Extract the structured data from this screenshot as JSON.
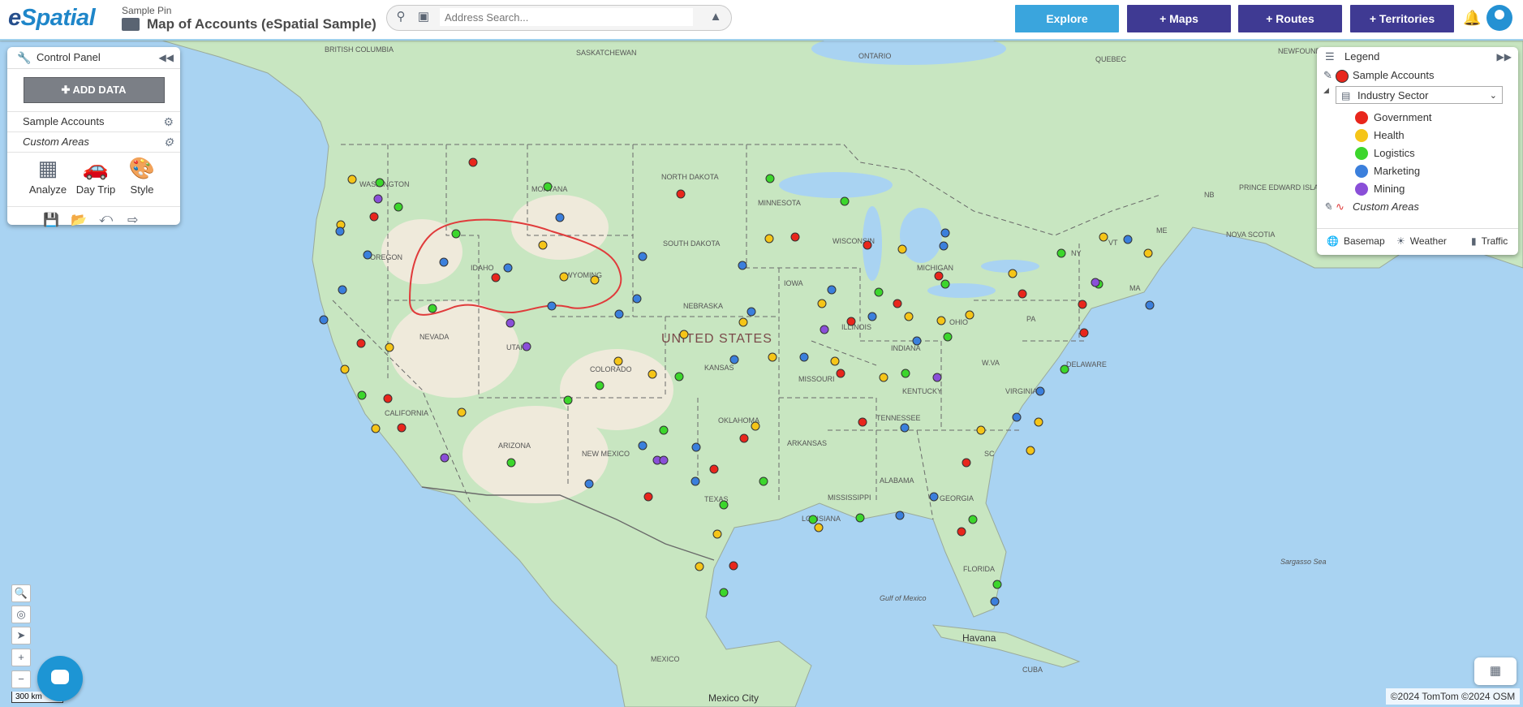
{
  "header": {
    "logo_prefix": "e",
    "logo_rest": "Spatial",
    "subtitle": "Sample Pin",
    "map_title": "Map of Accounts (eSpatial Sample)",
    "search_placeholder": "Address Search...",
    "nav": {
      "explore": "Explore",
      "maps": "+ Maps",
      "routes": "+ Routes",
      "territories": "+ Territories"
    }
  },
  "control_panel": {
    "title": "Control Panel",
    "add_data": "ADD DATA",
    "layers": [
      "Sample Accounts",
      "Custom Areas"
    ],
    "tools": [
      "Analyze",
      "Day Trip",
      "Style"
    ]
  },
  "legend": {
    "title": "Legend",
    "layer": "Sample Accounts",
    "group_by": "Industry Sector",
    "categories": [
      {
        "label": "Government",
        "color": "#e8261c"
      },
      {
        "label": "Health",
        "color": "#f5c518"
      },
      {
        "label": "Logistics",
        "color": "#3cd62c"
      },
      {
        "label": "Marketing",
        "color": "#3b7fdc"
      },
      {
        "label": "Mining",
        "color": "#8a4fd8"
      }
    ],
    "areas_label": "Custom Areas",
    "footer": [
      "Basemap",
      "Weather",
      "Traffic"
    ]
  },
  "map": {
    "country_label": "UNITED STATES",
    "labels": [
      "BRITISH COLUMBIA",
      "SASKATCHEWAN",
      "ONTARIO",
      "QUEBEC",
      "NEWFOUNDLAND AND LABRADOR",
      "WASHINGTON",
      "OREGON",
      "IDAHO",
      "MONTANA",
      "WYOMING",
      "NORTH DAKOTA",
      "SOUTH DAKOTA",
      "MINNESOTA",
      "NEBRASKA",
      "IOWA",
      "WISCONSIN",
      "MICHIGAN",
      "NEVADA",
      "UTAH",
      "COLORADO",
      "KANSAS",
      "MISSOURI",
      "ILLINOIS",
      "INDIANA",
      "CALIFORNIA",
      "ARIZONA",
      "NEW MEXICO",
      "OKLAHOMA",
      "ARKANSAS",
      "TENNESSEE",
      "KENTUCKY",
      "TEXAS",
      "LOUISIANA",
      "MISSISSIPPI",
      "ALABAMA",
      "GEORGIA",
      "FLORIDA",
      "VIRGINIA",
      "PRINCE EDWARD ISLAND",
      "NOVA SCOTIA",
      "Gulf of Mexico",
      "Sargasso Sea",
      "Havana",
      "CUBA",
      "MEXICO",
      "Mexico City",
      "DELAWARE",
      "OHIO",
      "PA",
      "NY",
      "VT",
      "ME",
      "SC",
      "W.VA",
      "NB",
      "MA"
    ],
    "scale": "300 km",
    "attribution": "©2024 TomTom ©2024 OSM"
  }
}
